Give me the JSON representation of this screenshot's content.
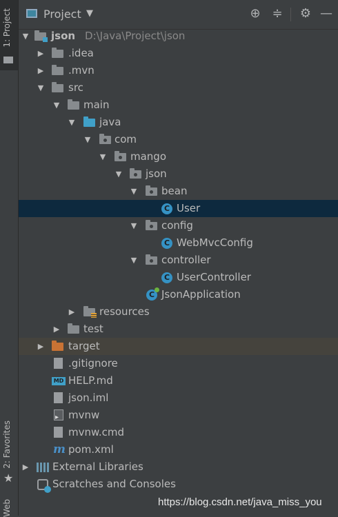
{
  "toolstrip": {
    "project_tab": "1: Project",
    "favorites_tab": "2: Favorites",
    "web_tab": "Web"
  },
  "header": {
    "title": "Project",
    "icons": [
      "target-icon",
      "collapse-icon",
      "gear-icon",
      "minimize-icon"
    ]
  },
  "tree": {
    "root": {
      "name": "json",
      "path": "D:\\Java\\Project\\json"
    },
    "idea": ".idea",
    "mvn": ".mvn",
    "src": "src",
    "main": "main",
    "java": "java",
    "com": "com",
    "mango": "mango",
    "json_pkg": "json",
    "bean": "bean",
    "user": "User",
    "config": "config",
    "webmvcconfig": "WebMvcConfig",
    "controller": "controller",
    "usercontroller": "UserController",
    "jsonapplication": "JsonApplication",
    "resources": "resources",
    "test": "test",
    "target": "target",
    "gitignore": ".gitignore",
    "help": "HELP.md",
    "json_iml": "json.iml",
    "mvnw": "mvnw",
    "mvnw_cmd": "mvnw.cmd",
    "pom": "pom.xml",
    "external_libraries": "External Libraries",
    "scratches": "Scratches and Consoles"
  },
  "icons": {
    "md_badge": "MD",
    "class_badge": "C",
    "maven_badge": "m"
  },
  "watermark": "https://blog.csdn.net/java_miss_you",
  "colors": {
    "selection": "#0d293e",
    "background": "#3c3f41",
    "source_folder": "#40a0c8",
    "excluded_folder": "#c97334"
  }
}
